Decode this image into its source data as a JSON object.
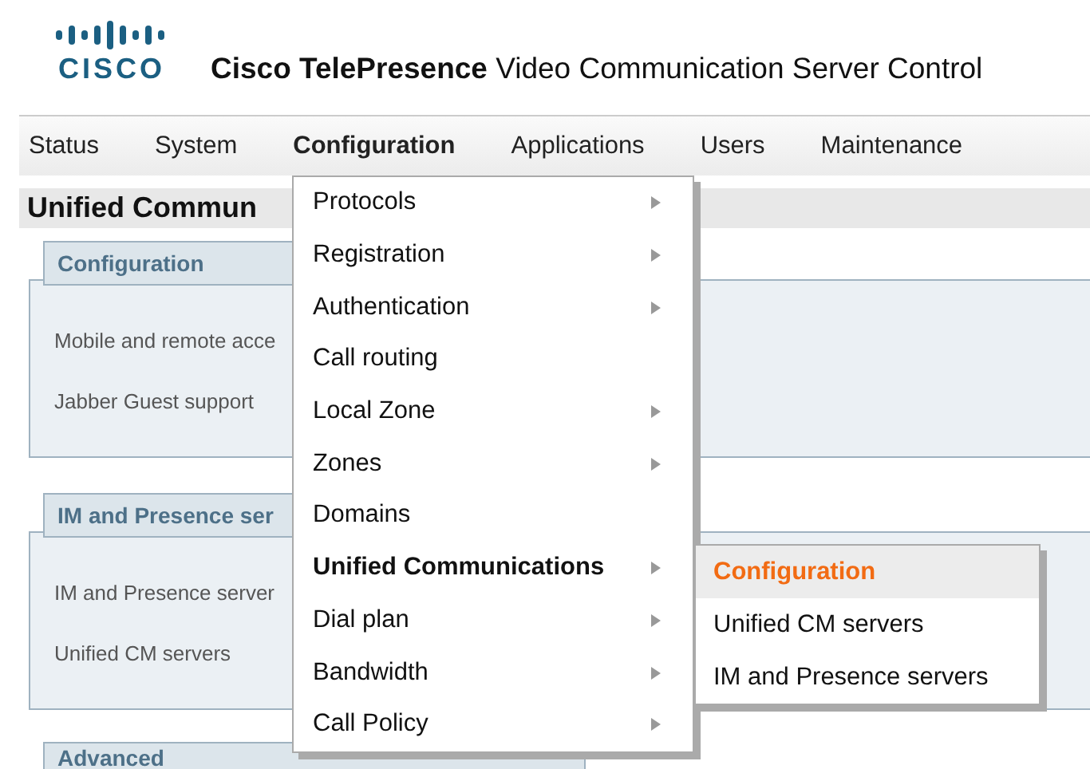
{
  "logo": {
    "text": "CISCO"
  },
  "header": {
    "title": "**Cisco TelePresence** Video Communication Server Control"
  },
  "nav": [
    {
      "label": "Status",
      "selected": false
    },
    {
      "label": "System",
      "selected": false
    },
    {
      "label": "Configuration",
      "selected": true
    },
    {
      "label": "Applications",
      "selected": false
    },
    {
      "label": "Users",
      "selected": false
    },
    {
      "label": "Maintenance",
      "selected": false
    }
  ],
  "page_title": "Unified Commun",
  "sections": [
    {
      "heading": "Configuration",
      "rows": [
        "Mobile and remote acce",
        "Jabber Guest support"
      ]
    },
    {
      "heading": "IM and Presence ser",
      "rows": [
        "IM and Presence server",
        "Unified CM servers"
      ]
    },
    {
      "heading": "Advanced"
    }
  ],
  "menu": [
    {
      "label": "Protocols",
      "has_submenu": true,
      "selected": false
    },
    {
      "label": "Registration",
      "has_submenu": true,
      "selected": false
    },
    {
      "label": "Authentication",
      "has_submenu": true,
      "selected": false
    },
    {
      "label": "Call routing",
      "has_submenu": false,
      "selected": false
    },
    {
      "label": "Local Zone",
      "has_submenu": true,
      "selected": false
    },
    {
      "label": "Zones",
      "has_submenu": true,
      "selected": false
    },
    {
      "label": "Domains",
      "has_submenu": false,
      "selected": false
    },
    {
      "label": "Unified Communications",
      "has_submenu": true,
      "selected": true
    },
    {
      "label": "Dial plan",
      "has_submenu": true,
      "selected": false
    },
    {
      "label": "Bandwidth",
      "has_submenu": true,
      "selected": false
    },
    {
      "label": "Call Policy",
      "has_submenu": true,
      "selected": false
    }
  ],
  "submenu": [
    {
      "label": "Configuration",
      "selected": true
    },
    {
      "label": "Unified CM servers",
      "selected": false
    },
    {
      "label": "IM and Presence servers",
      "selected": false
    }
  ]
}
